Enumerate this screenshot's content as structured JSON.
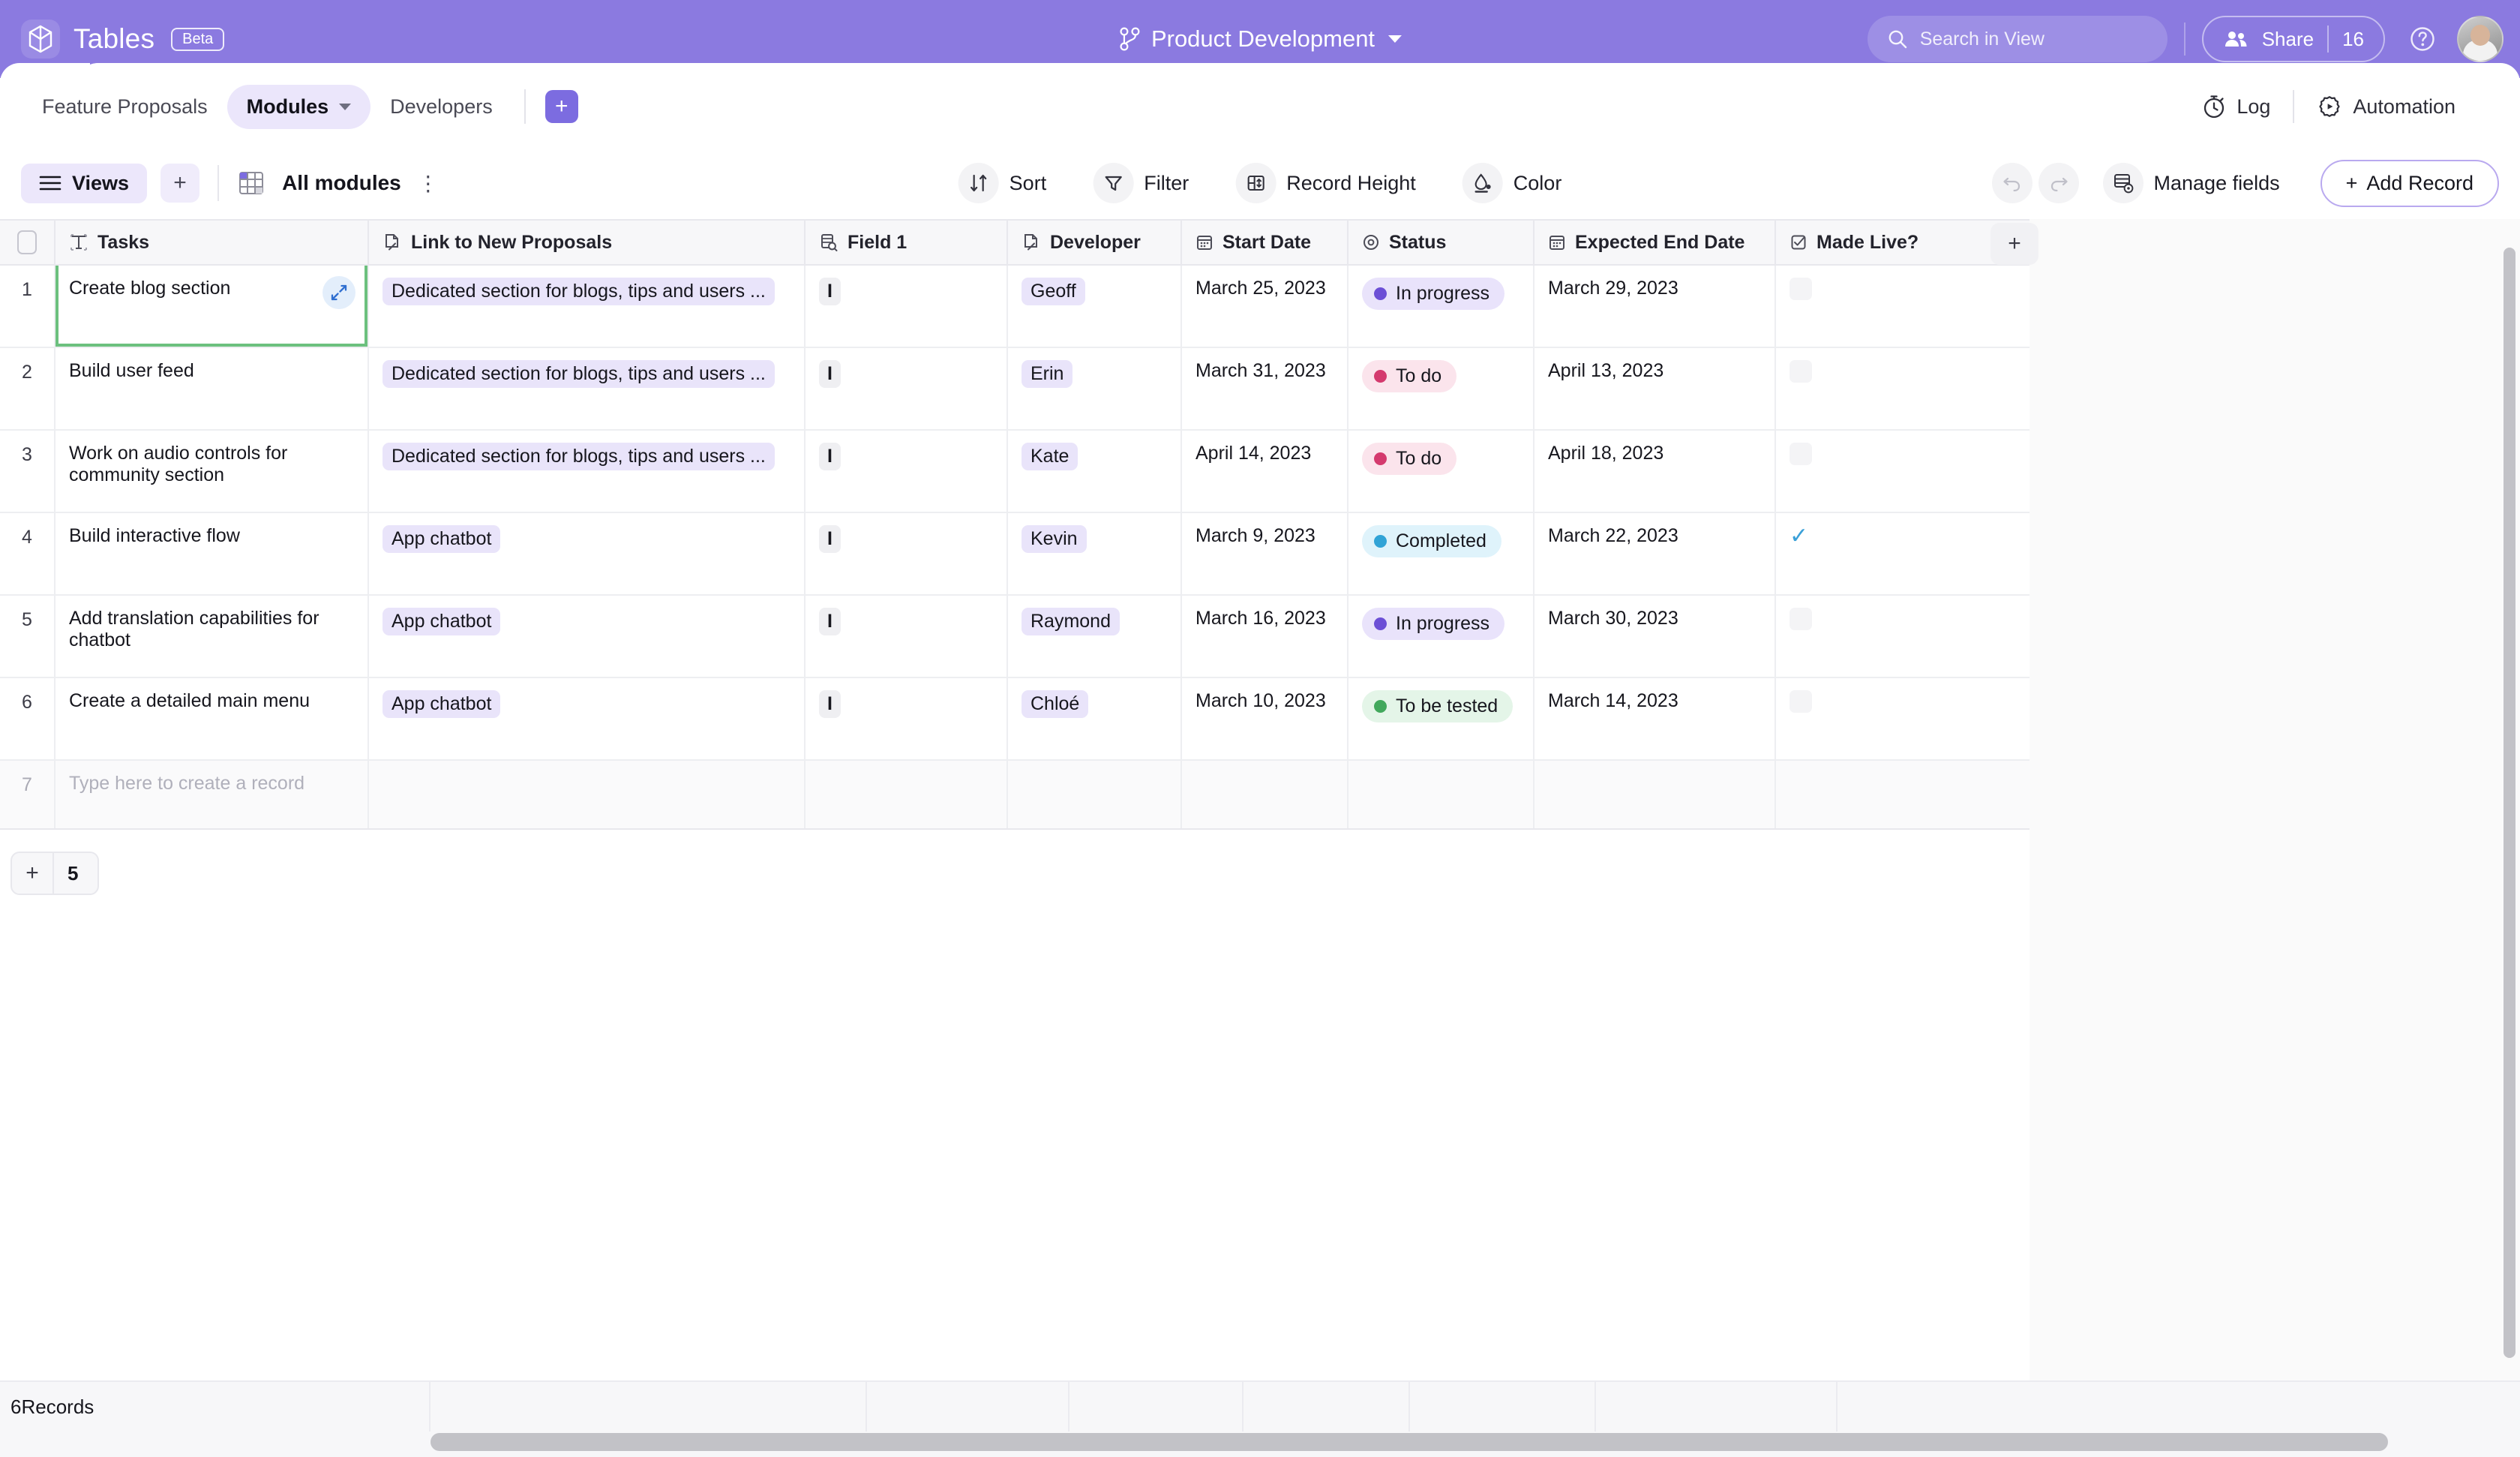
{
  "header": {
    "brand": "Tables",
    "badge": "Beta",
    "workspace": "Product Development",
    "search_placeholder": "Search in View",
    "share_label": "Share",
    "share_count": "16"
  },
  "tabs": {
    "items": [
      {
        "label": "Feature Proposals",
        "active": false,
        "has_caret": false
      },
      {
        "label": "Modules",
        "active": true,
        "has_caret": true
      },
      {
        "label": "Developers",
        "active": false,
        "has_caret": false
      }
    ],
    "add_label": "+",
    "log_label": "Log",
    "automation_label": "Automation"
  },
  "toolbar": {
    "views_label": "Views",
    "views_add_label": "+",
    "view_name": "All modules",
    "kebab_label": "⋮",
    "sort_label": "Sort",
    "filter_label": "Filter",
    "record_height_label": "Record Height",
    "color_label": "Color",
    "manage_fields_label": "Manage fields",
    "add_record_label": "Add Record"
  },
  "grid": {
    "columns": [
      {
        "key": "check",
        "label": "",
        "icon": "checkbox-icon"
      },
      {
        "key": "tasks",
        "label": "Tasks",
        "icon": "text-field-icon"
      },
      {
        "key": "link",
        "label": "Link to New Proposals",
        "icon": "link-record-icon"
      },
      {
        "key": "field1",
        "label": "Field 1",
        "icon": "lookup-icon"
      },
      {
        "key": "dev",
        "label": "Developer",
        "icon": "link-record-icon"
      },
      {
        "key": "start",
        "label": "Start Date",
        "icon": "calendar-icon"
      },
      {
        "key": "status",
        "label": "Status",
        "icon": "single-select-icon"
      },
      {
        "key": "end",
        "label": "Expected End Date",
        "icon": "calendar-icon"
      },
      {
        "key": "live",
        "label": "Made Live?",
        "icon": "checkbox-field-icon"
      }
    ],
    "add_column_label": "+",
    "rows": [
      {
        "num": "1",
        "tasks": "Create blog section",
        "link": "Dedicated section for blogs, tips and users ...",
        "field1": "I",
        "dev": "Geoff",
        "start": "March 25, 2023",
        "status": "In progress",
        "status_color": "#6c4fd6",
        "status_bg": "#e9e3fb",
        "end": "March 29, 2023",
        "live": false,
        "selected": true
      },
      {
        "num": "2",
        "tasks": "Build user feed",
        "link": "Dedicated section for blogs, tips and users ...",
        "field1": "I",
        "dev": "Erin",
        "start": "March 31, 2023",
        "status": "To do",
        "status_color": "#d43a6e",
        "status_bg": "#fbe4ec",
        "end": "April 13, 2023",
        "live": false,
        "selected": false
      },
      {
        "num": "3",
        "tasks": "Work on audio controls for community section",
        "link": "Dedicated section for blogs, tips and users ...",
        "field1": "I",
        "dev": "Kate",
        "start": "April 14, 2023",
        "status": "To do",
        "status_color": "#d43a6e",
        "status_bg": "#fbe4ec",
        "end": "April 18, 2023",
        "live": false,
        "selected": false
      },
      {
        "num": "4",
        "tasks": "Build interactive flow",
        "link": "App chatbot",
        "field1": "I",
        "dev": "Kevin",
        "start": "March 9, 2023",
        "status": "Completed",
        "status_color": "#31a3d6",
        "status_bg": "#dff3fb",
        "end": "March 22, 2023",
        "live": true,
        "selected": false
      },
      {
        "num": "5",
        "tasks": "Add translation capabilities for chatbot",
        "link": "App chatbot",
        "field1": "I",
        "dev": "Raymond",
        "start": "March 16, 2023",
        "status": "In progress",
        "status_color": "#6c4fd6",
        "status_bg": "#e9e3fb",
        "end": "March 30, 2023",
        "live": false,
        "selected": false
      },
      {
        "num": "6",
        "tasks": "Create a detailed main menu",
        "link": "App chatbot",
        "field1": "I",
        "dev": "Chloé",
        "start": "March 10, 2023",
        "status": "To be tested",
        "status_color": "#42a85c",
        "status_bg": "#e4f5e8",
        "end": "March 14, 2023",
        "live": false,
        "selected": false
      }
    ],
    "new_row": {
      "num": "7",
      "placeholder": "Type here to create a record"
    },
    "add_rows": {
      "plus": "+",
      "count": "5"
    }
  },
  "footer": {
    "records_label": "6Records"
  },
  "colors": {
    "brand_purple": "#8b7ae0",
    "accent_purple": "#7c6ce0",
    "selection_green": "#6cc07e",
    "chip_lavender": "#e9e4fa"
  }
}
